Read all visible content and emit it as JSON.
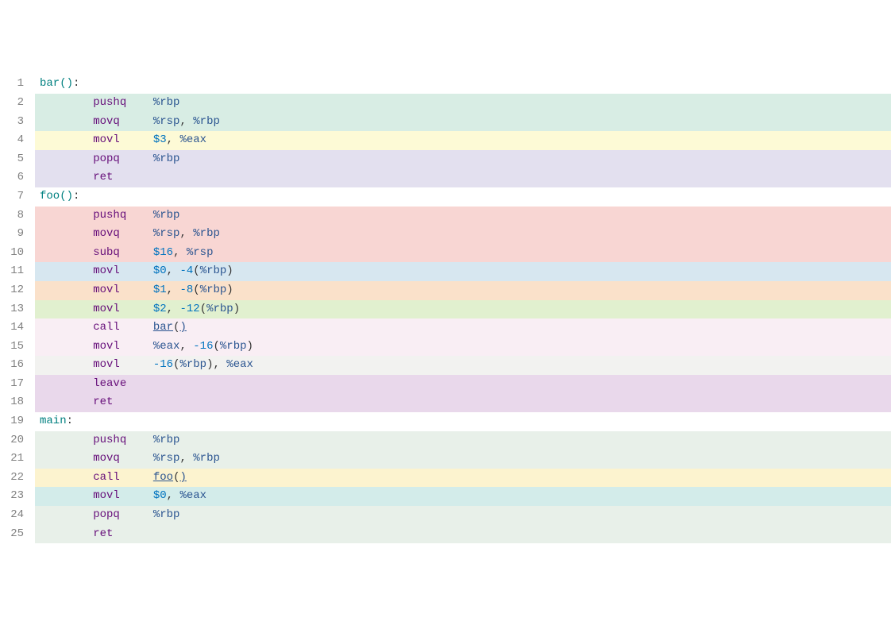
{
  "lines": [
    {
      "num": "1",
      "bg": "bg-white",
      "tokens": [
        {
          "cls": "tok-label",
          "text": "bar"
        },
        {
          "cls": "tok-paren",
          "text": "()"
        },
        {
          "cls": "tok-colon",
          "text": ":"
        }
      ]
    },
    {
      "num": "2",
      "bg": "bg-teal-light",
      "indent": 1,
      "tokens": [
        {
          "cls": "tok-op",
          "text": "pushq"
        },
        {
          "pad": 4,
          "cls": "tok-reg",
          "text": "%rbp"
        }
      ]
    },
    {
      "num": "3",
      "bg": "bg-teal-light",
      "indent": 1,
      "tokens": [
        {
          "cls": "tok-op",
          "text": "movq"
        },
        {
          "pad": 5,
          "cls": "tok-reg",
          "text": "%rsp"
        },
        {
          "cls": "tok-comma",
          "text": ", "
        },
        {
          "cls": "tok-reg",
          "text": "%rbp"
        }
      ]
    },
    {
      "num": "4",
      "bg": "bg-yellow-light",
      "indent": 1,
      "tokens": [
        {
          "cls": "tok-op",
          "text": "movl"
        },
        {
          "pad": 5,
          "cls": "tok-num",
          "text": "$3"
        },
        {
          "cls": "tok-comma",
          "text": ", "
        },
        {
          "cls": "tok-reg",
          "text": "%eax"
        }
      ]
    },
    {
      "num": "5",
      "bg": "bg-lavender",
      "indent": 1,
      "tokens": [
        {
          "cls": "tok-op",
          "text": "popq"
        },
        {
          "pad": 5,
          "cls": "tok-reg",
          "text": "%rbp"
        }
      ]
    },
    {
      "num": "6",
      "bg": "bg-lavender",
      "indent": 1,
      "tokens": [
        {
          "cls": "tok-op",
          "text": "ret"
        }
      ]
    },
    {
      "num": "7",
      "bg": "bg-white",
      "tokens": [
        {
          "cls": "tok-label",
          "text": "foo"
        },
        {
          "cls": "tok-paren",
          "text": "()"
        },
        {
          "cls": "tok-colon",
          "text": ":"
        }
      ]
    },
    {
      "num": "8",
      "bg": "bg-pink",
      "indent": 1,
      "tokens": [
        {
          "cls": "tok-op",
          "text": "pushq"
        },
        {
          "pad": 4,
          "cls": "tok-reg",
          "text": "%rbp"
        }
      ]
    },
    {
      "num": "9",
      "bg": "bg-pink",
      "indent": 1,
      "tokens": [
        {
          "cls": "tok-op",
          "text": "movq"
        },
        {
          "pad": 5,
          "cls": "tok-reg",
          "text": "%rsp"
        },
        {
          "cls": "tok-comma",
          "text": ", "
        },
        {
          "cls": "tok-reg",
          "text": "%rbp"
        }
      ]
    },
    {
      "num": "10",
      "bg": "bg-pink",
      "indent": 1,
      "tokens": [
        {
          "cls": "tok-op",
          "text": "subq"
        },
        {
          "pad": 5,
          "cls": "tok-num",
          "text": "$16"
        },
        {
          "cls": "tok-comma",
          "text": ", "
        },
        {
          "cls": "tok-reg",
          "text": "%rsp"
        }
      ]
    },
    {
      "num": "11",
      "bg": "bg-blue-light",
      "indent": 1,
      "tokens": [
        {
          "cls": "tok-op",
          "text": "movl"
        },
        {
          "pad": 5,
          "cls": "tok-num",
          "text": "$0"
        },
        {
          "cls": "tok-comma",
          "text": ", "
        },
        {
          "cls": "tok-num",
          "text": "-4"
        },
        {
          "cls": "tok-punc",
          "text": "("
        },
        {
          "cls": "tok-reg",
          "text": "%rbp"
        },
        {
          "cls": "tok-punc",
          "text": ")"
        }
      ]
    },
    {
      "num": "12",
      "bg": "bg-orange-light",
      "indent": 1,
      "tokens": [
        {
          "cls": "tok-op",
          "text": "movl"
        },
        {
          "pad": 5,
          "cls": "tok-num",
          "text": "$1"
        },
        {
          "cls": "tok-comma",
          "text": ", "
        },
        {
          "cls": "tok-num",
          "text": "-8"
        },
        {
          "cls": "tok-punc",
          "text": "("
        },
        {
          "cls": "tok-reg",
          "text": "%rbp"
        },
        {
          "cls": "tok-punc",
          "text": ")"
        }
      ]
    },
    {
      "num": "13",
      "bg": "bg-green-light",
      "indent": 1,
      "tokens": [
        {
          "cls": "tok-op",
          "text": "movl"
        },
        {
          "pad": 5,
          "cls": "tok-num",
          "text": "$2"
        },
        {
          "cls": "tok-comma",
          "text": ", "
        },
        {
          "cls": "tok-num",
          "text": "-12"
        },
        {
          "cls": "tok-punc",
          "text": "("
        },
        {
          "cls": "tok-reg",
          "text": "%rbp"
        },
        {
          "cls": "tok-punc",
          "text": ")"
        }
      ]
    },
    {
      "num": "14",
      "bg": "bg-pinkish",
      "indent": 1,
      "tokens": [
        {
          "cls": "tok-op",
          "text": "call"
        },
        {
          "pad": 5,
          "cls": "tok-underline",
          "text": "bar"
        },
        {
          "cls": "tok-punc",
          "text": "("
        },
        {
          "cls": "tok-underline",
          "text": ")"
        }
      ]
    },
    {
      "num": "15",
      "bg": "bg-pinkish",
      "indent": 1,
      "tokens": [
        {
          "cls": "tok-op",
          "text": "movl"
        },
        {
          "pad": 5,
          "cls": "tok-reg",
          "text": "%eax"
        },
        {
          "cls": "tok-comma",
          "text": ", "
        },
        {
          "cls": "tok-num",
          "text": "-16"
        },
        {
          "cls": "tok-punc",
          "text": "("
        },
        {
          "cls": "tok-reg",
          "text": "%rbp"
        },
        {
          "cls": "tok-punc",
          "text": ")"
        }
      ]
    },
    {
      "num": "16",
      "bg": "bg-gray-light",
      "indent": 1,
      "tokens": [
        {
          "cls": "tok-op",
          "text": "movl"
        },
        {
          "pad": 5,
          "cls": "tok-num",
          "text": "-16"
        },
        {
          "cls": "tok-punc",
          "text": "("
        },
        {
          "cls": "tok-reg",
          "text": "%rbp"
        },
        {
          "cls": "tok-punc",
          "text": ")"
        },
        {
          "cls": "tok-comma",
          "text": ", "
        },
        {
          "cls": "tok-reg",
          "text": "%eax"
        }
      ]
    },
    {
      "num": "17",
      "bg": "bg-purple-light",
      "indent": 1,
      "tokens": [
        {
          "cls": "tok-op",
          "text": "leave"
        }
      ]
    },
    {
      "num": "18",
      "bg": "bg-purple-light",
      "indent": 1,
      "tokens": [
        {
          "cls": "tok-op",
          "text": "ret"
        }
      ]
    },
    {
      "num": "19",
      "bg": "bg-white",
      "tokens": [
        {
          "cls": "tok-label",
          "text": "main"
        },
        {
          "cls": "tok-colon",
          "text": ":"
        }
      ]
    },
    {
      "num": "20",
      "bg": "bg-mint",
      "indent": 1,
      "tokens": [
        {
          "cls": "tok-op",
          "text": "pushq"
        },
        {
          "pad": 4,
          "cls": "tok-reg",
          "text": "%rbp"
        }
      ]
    },
    {
      "num": "21",
      "bg": "bg-mint",
      "indent": 1,
      "tokens": [
        {
          "cls": "tok-op",
          "text": "movq"
        },
        {
          "pad": 5,
          "cls": "tok-reg",
          "text": "%rsp"
        },
        {
          "cls": "tok-comma",
          "text": ", "
        },
        {
          "cls": "tok-reg",
          "text": "%rbp"
        }
      ]
    },
    {
      "num": "22",
      "bg": "bg-yellow2",
      "indent": 1,
      "tokens": [
        {
          "cls": "tok-op",
          "text": "call"
        },
        {
          "pad": 5,
          "cls": "tok-underline",
          "text": "foo"
        },
        {
          "cls": "tok-punc",
          "text": "("
        },
        {
          "cls": "tok-underline",
          "text": ")"
        }
      ]
    },
    {
      "num": "23",
      "bg": "bg-teal2",
      "indent": 1,
      "tokens": [
        {
          "cls": "tok-op",
          "text": "movl"
        },
        {
          "pad": 5,
          "cls": "tok-num",
          "text": "$0"
        },
        {
          "cls": "tok-comma",
          "text": ", "
        },
        {
          "cls": "tok-reg",
          "text": "%eax"
        }
      ]
    },
    {
      "num": "24",
      "bg": "bg-mint",
      "indent": 1,
      "tokens": [
        {
          "cls": "tok-op",
          "text": "popq"
        },
        {
          "pad": 5,
          "cls": "tok-reg",
          "text": "%rbp"
        }
      ]
    },
    {
      "num": "25",
      "bg": "bg-mint",
      "indent": 1,
      "tokens": [
        {
          "cls": "tok-op",
          "text": "ret"
        }
      ]
    }
  ]
}
